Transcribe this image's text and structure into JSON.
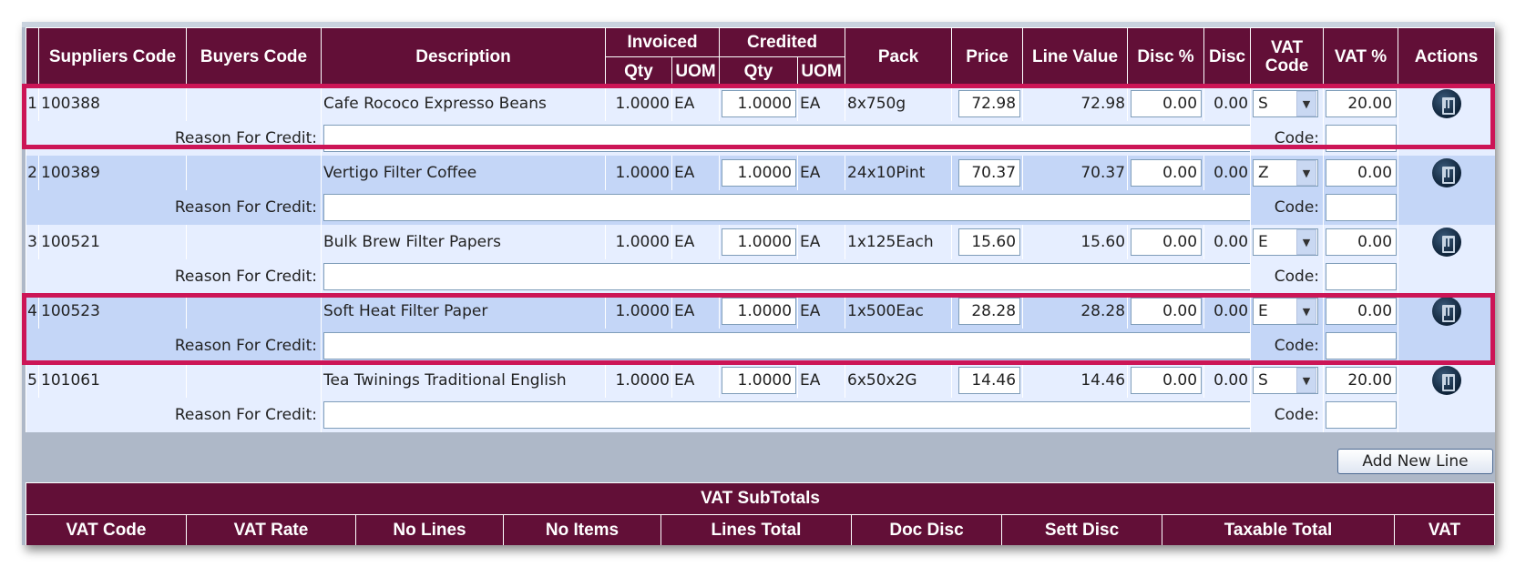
{
  "columns": {
    "suppliers_code": "Suppliers Code",
    "buyers_code": "Buyers Code",
    "description": "Description",
    "invoiced": "Invoiced",
    "credited": "Credited",
    "qty": "Qty",
    "uom": "UOM",
    "pack": "Pack",
    "price": "Price",
    "line_value": "Line Value",
    "disc_pct": "Disc %",
    "disc": "Disc",
    "vat_code": "VAT Code",
    "vat_pct": "VAT %",
    "actions": "Actions"
  },
  "reason_label": "Reason For Credit:",
  "code_label": "Code:",
  "rows": [
    {
      "n": "1",
      "supplier_code": "100388",
      "buyers_code": "",
      "description": "Cafe Rococo Expresso Beans",
      "inv_qty": "1.0000",
      "inv_uom": "EA",
      "cred_qty": "1.0000",
      "cred_uom": "EA",
      "pack": "8x750g",
      "price": "72.98",
      "line_value": "72.98",
      "disc_pct": "0.00",
      "disc": "0.00",
      "vat_code": "S",
      "vat_pct": "20.00",
      "reason": "",
      "code": ""
    },
    {
      "n": "2",
      "supplier_code": "100389",
      "buyers_code": "",
      "description": "Vertigo Filter Coffee",
      "inv_qty": "1.0000",
      "inv_uom": "EA",
      "cred_qty": "1.0000",
      "cred_uom": "EA",
      "pack": "24x10Pint",
      "price": "70.37",
      "line_value": "70.37",
      "disc_pct": "0.00",
      "disc": "0.00",
      "vat_code": "Z",
      "vat_pct": "0.00",
      "reason": "",
      "code": ""
    },
    {
      "n": "3",
      "supplier_code": "100521",
      "buyers_code": "",
      "description": "Bulk Brew Filter Papers",
      "inv_qty": "1.0000",
      "inv_uom": "EA",
      "cred_qty": "1.0000",
      "cred_uom": "EA",
      "pack": "1x125Each",
      "price": "15.60",
      "line_value": "15.60",
      "disc_pct": "0.00",
      "disc": "0.00",
      "vat_code": "E",
      "vat_pct": "0.00",
      "reason": "",
      "code": ""
    },
    {
      "n": "4",
      "supplier_code": "100523",
      "buyers_code": "",
      "description": "Soft Heat Filter Paper",
      "inv_qty": "1.0000",
      "inv_uom": "EA",
      "cred_qty": "1.0000",
      "cred_uom": "EA",
      "pack": "1x500Eac",
      "price": "28.28",
      "line_value": "28.28",
      "disc_pct": "0.00",
      "disc": "0.00",
      "vat_code": "E",
      "vat_pct": "0.00",
      "reason": "",
      "code": ""
    },
    {
      "n": "5",
      "supplier_code": "101061",
      "buyers_code": "",
      "description": "Tea Twinings Traditional English",
      "inv_qty": "1.0000",
      "inv_uom": "EA",
      "cred_qty": "1.0000",
      "cred_uom": "EA",
      "pack": "6x50x2G",
      "price": "14.46",
      "line_value": "14.46",
      "disc_pct": "0.00",
      "disc": "0.00",
      "vat_code": "S",
      "vat_pct": "20.00",
      "reason": "",
      "code": ""
    }
  ],
  "add_new_line_label": "Add New Line",
  "vat_subtotals": {
    "title": "VAT SubTotals",
    "headers": [
      "VAT Code",
      "VAT Rate",
      "No Lines",
      "No Items",
      "Lines Total",
      "Doc Disc",
      "Sett Disc",
      "Taxable Total",
      "VAT"
    ]
  },
  "icons": {
    "delete": "trash-icon",
    "dropdown": "chevron-down-icon",
    "cursor": "mouse-pointer-icon"
  },
  "colors": {
    "header_bg": "#620f37",
    "row_light": "#e6eeff",
    "row_dark": "#c4d6f7",
    "highlight": "#cc1556"
  }
}
